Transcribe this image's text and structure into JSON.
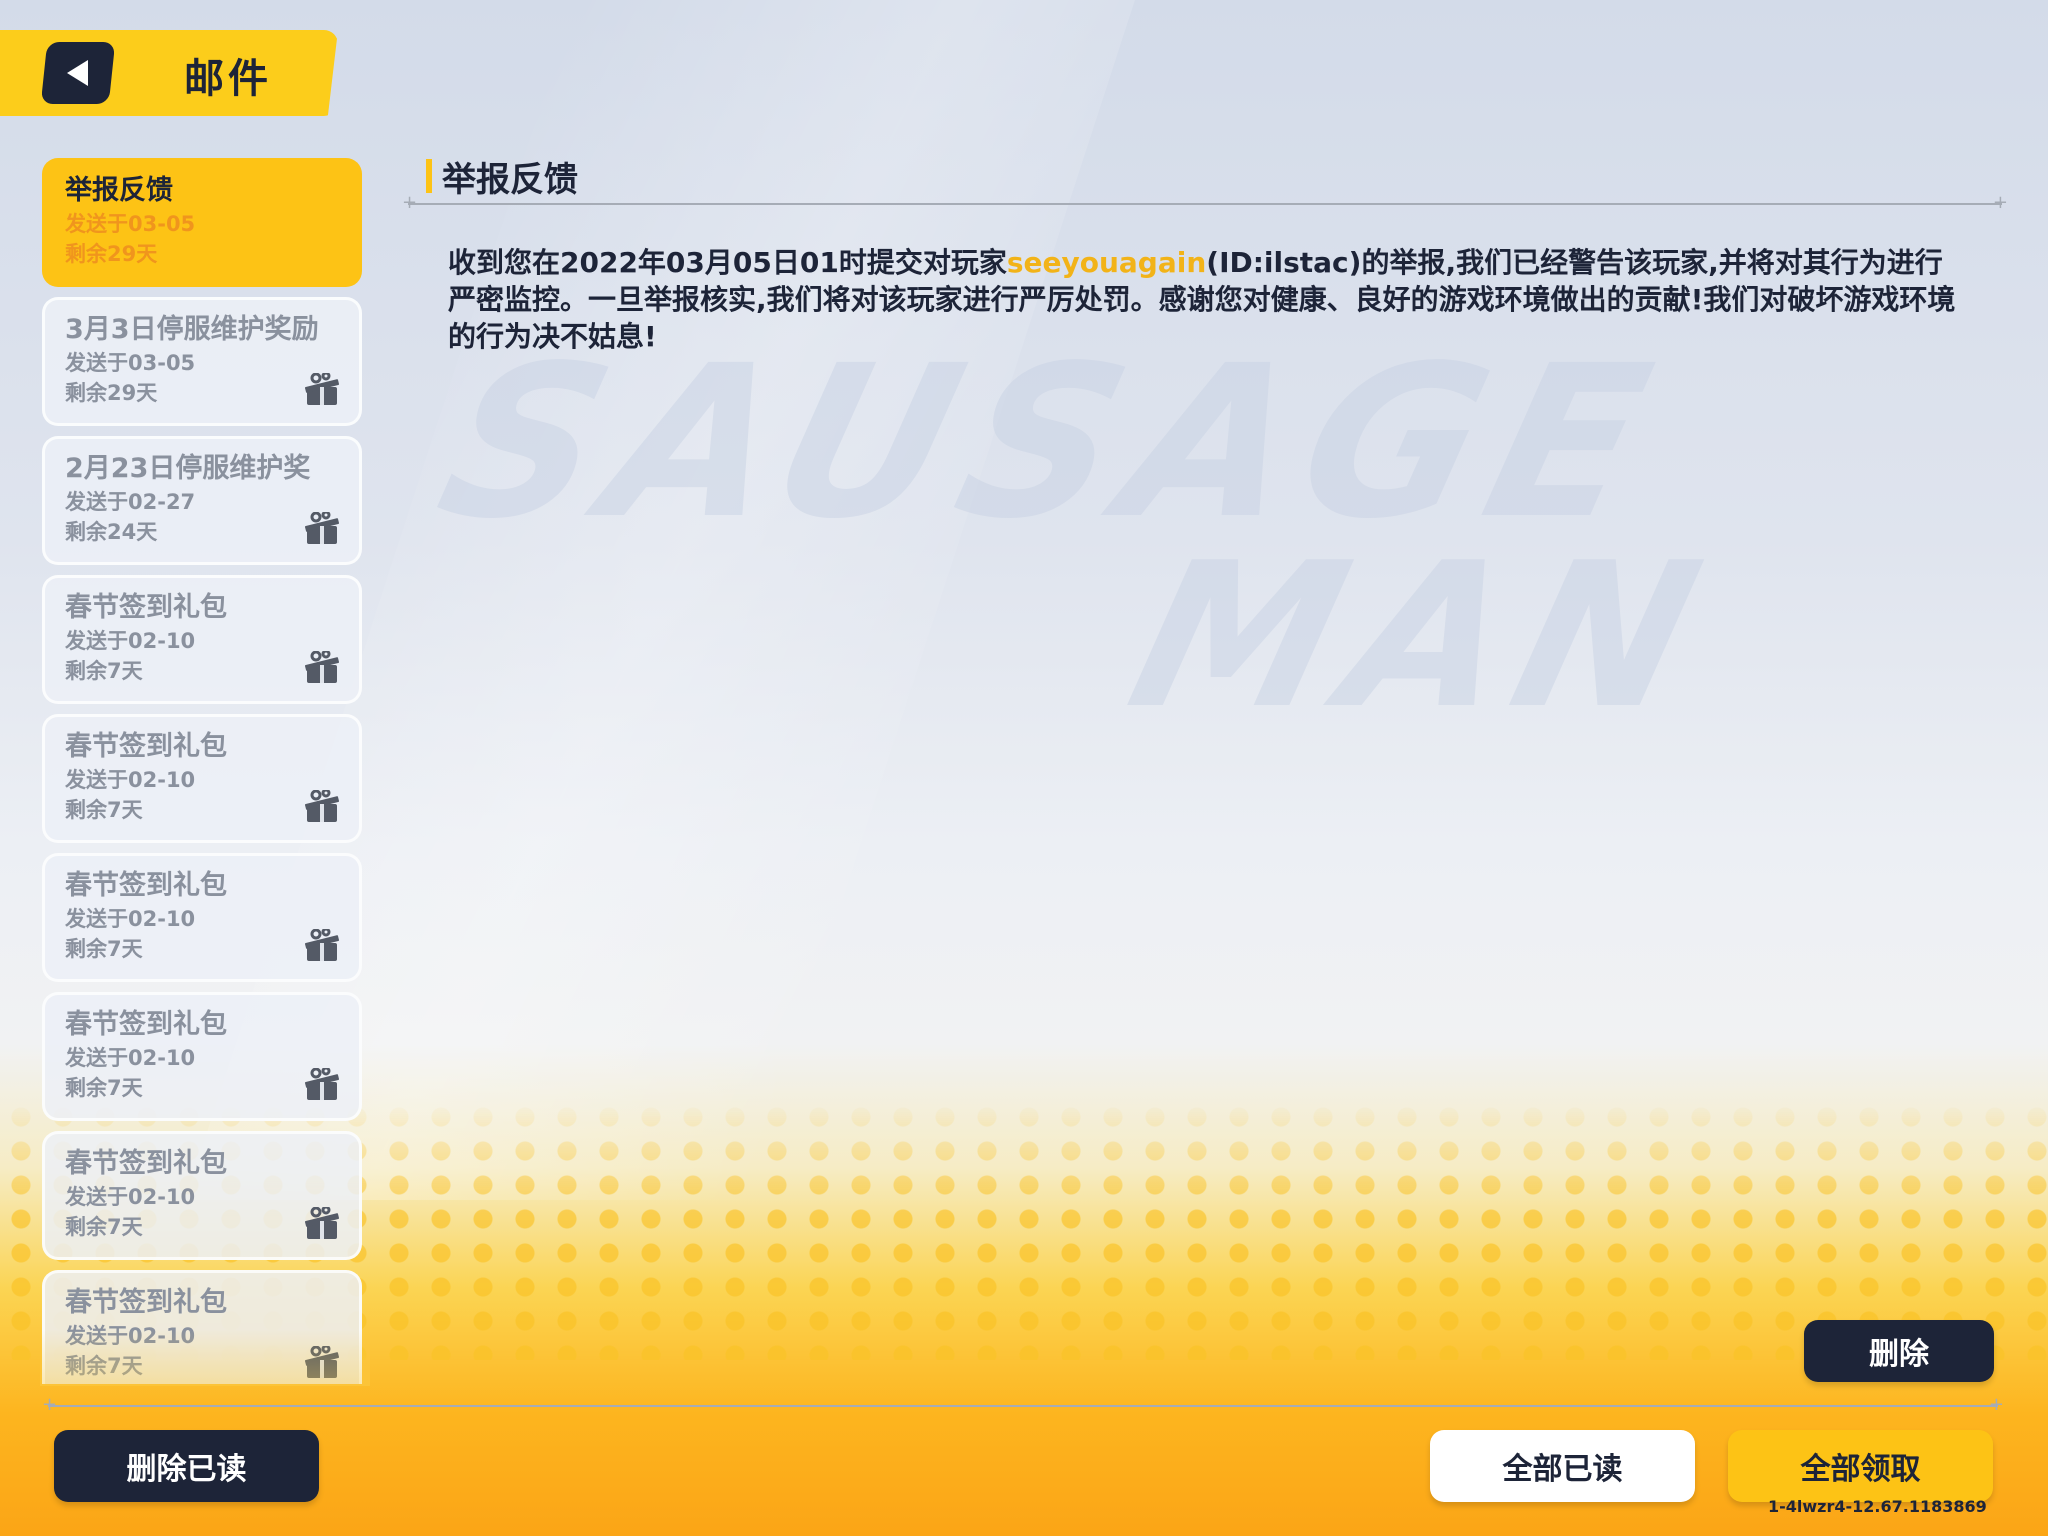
{
  "header": {
    "title": "邮件"
  },
  "mails": [
    {
      "title": "举报反馈",
      "sent": "发送于03-05",
      "remaining": "剩余29天",
      "active": true,
      "gift": false
    },
    {
      "title": "3月3日停服维护奖励",
      "sent": "发送于03-05",
      "remaining": "剩余29天",
      "active": false,
      "gift": true
    },
    {
      "title": "2月23日停服维护奖",
      "sent": "发送于02-27",
      "remaining": "剩余24天",
      "active": false,
      "gift": true
    },
    {
      "title": "春节签到礼包",
      "sent": "发送于02-10",
      "remaining": "剩余7天",
      "active": false,
      "gift": true
    },
    {
      "title": "春节签到礼包",
      "sent": "发送于02-10",
      "remaining": "剩余7天",
      "active": false,
      "gift": true
    },
    {
      "title": "春节签到礼包",
      "sent": "发送于02-10",
      "remaining": "剩余7天",
      "active": false,
      "gift": true
    },
    {
      "title": "春节签到礼包",
      "sent": "发送于02-10",
      "remaining": "剩余7天",
      "active": false,
      "gift": true
    },
    {
      "title": "春节签到礼包",
      "sent": "发送于02-10",
      "remaining": "剩余7天",
      "active": false,
      "gift": true
    },
    {
      "title": "春节签到礼包",
      "sent": "发送于02-10",
      "remaining": "剩余7天",
      "active": false,
      "gift": true
    }
  ],
  "content": {
    "title": "举报反馈",
    "body_before": "收到您在2022年03月05日01时提交对玩家",
    "player_name": "seeyouagain",
    "body_after": "(ID:ilstac)的举报,我们已经警告该玩家,并将对其行为进行严密监控。一旦举报核实,我们将对该玩家进行严厉处罚。感谢您对健康、良好的游戏环境做出的贡献!我们对破坏游戏环境的行为决不姑息!"
  },
  "buttons": {
    "delete": "删除",
    "delete_read": "删除已读",
    "read_all": "全部已读",
    "claim_all": "全部领取"
  },
  "version": "1-4lwzr4-12.67.1183869",
  "watermark": {
    "line1": "SAUSAGE",
    "line2": "MAN"
  },
  "colors": {
    "accent": "#fdc315",
    "dark": "#1d2438",
    "highlight": "#f2b318"
  },
  "icons": {
    "back": "back-arrow-icon",
    "gift": "gift-icon"
  }
}
